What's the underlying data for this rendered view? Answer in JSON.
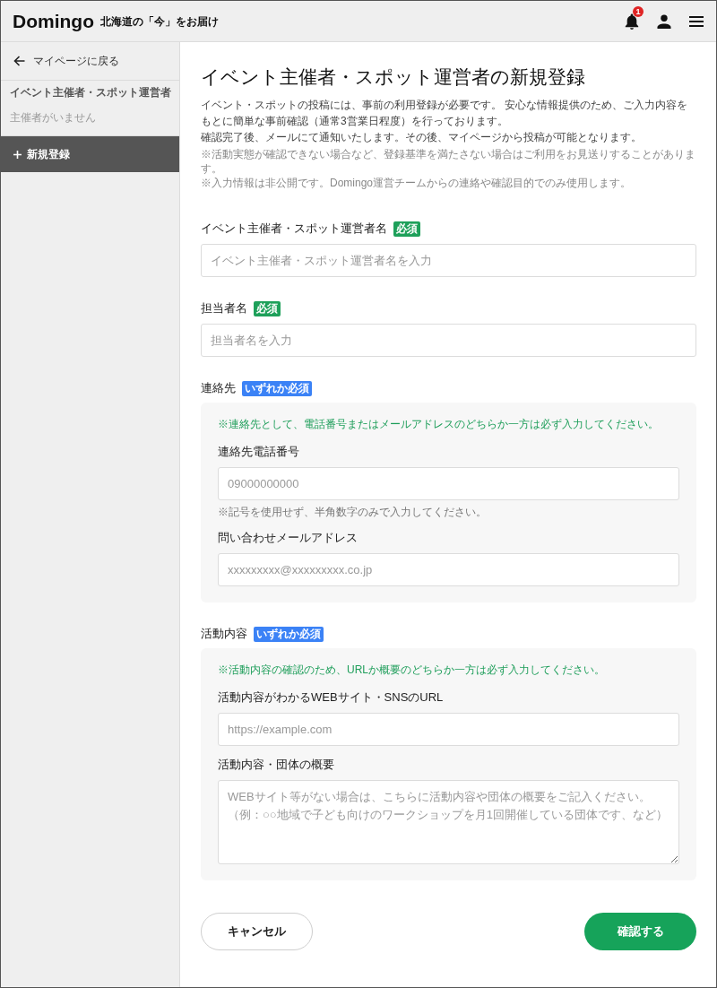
{
  "header": {
    "logo": "Domingo",
    "tagline": "北海道の「今」をお届け",
    "notification_badge": "1"
  },
  "sidebar": {
    "back_link": "マイページに戻る",
    "section_label": "イベント主催者・スポット運営者",
    "empty_message": "主催者がいません",
    "items": [
      {
        "label": "新規登録",
        "selected": true
      }
    ]
  },
  "page": {
    "title": "イベント主催者・スポット運営者の新規登録",
    "intro": [
      "イベント・スポットの投稿には、事前の利用登録が必要です。 安心な情報提供のため、ご入力内容をもとに簡単な事前確認（通常3営業日程度）を行っております。",
      "確認完了後、メールにて通知いたします。その後、マイページから投稿が可能となります。"
    ],
    "notes": [
      "※活動実態が確認できない場合など、登録基準を満たさない場合はご利用をお見送りすることがあります。",
      "※入力情報は非公開です。Domingo運営チームからの連絡や確認目的でのみ使用します。"
    ]
  },
  "form": [
    {
      "kind": "input",
      "label": "イベント主催者・スポット運営者名",
      "badge": {
        "text": "必須",
        "color": "#1ea05a"
      },
      "placeholder": "イベント主催者・スポット運営者名を入力"
    },
    {
      "kind": "input",
      "label": "担当者名",
      "badge": {
        "text": "必須",
        "color": "#1ea05a"
      },
      "placeholder": "担当者名を入力"
    },
    {
      "kind": "group",
      "label": "連絡先",
      "badge": {
        "text": "いずれか必須",
        "color": "#3b82f6"
      },
      "note": "※連絡先として、電話番号またはメールアドレスのどちらか一方は必ず入力してください。",
      "fields": [
        {
          "kind": "input",
          "label": "連絡先電話番号",
          "placeholder": "09000000000",
          "hint": "※記号を使用せず、半角数字のみで入力してください。"
        },
        {
          "kind": "input",
          "label": "問い合わせメールアドレス",
          "placeholder": "xxxxxxxxx@xxxxxxxxx.co.jp"
        }
      ]
    },
    {
      "kind": "group",
      "label": "活動内容",
      "badge": {
        "text": "いずれか必須",
        "color": "#3b82f6"
      },
      "note": "※活動内容の確認のため、URLか概要のどちらか一方は必ず入力してください。",
      "fields": [
        {
          "kind": "input",
          "label": "活動内容がわかるWEBサイト・SNSのURL",
          "placeholder": "https://example.com"
        },
        {
          "kind": "textarea",
          "label": "活動内容・団体の概要",
          "placeholder": "WEBサイト等がない場合は、こちらに活動内容や団体の概要をご記入ください。（例：○○地域で子ども向けのワークショップを月1回開催している団体です、など）"
        }
      ]
    }
  ],
  "buttons": [
    {
      "label": "キャンセル",
      "kind": "secondary"
    },
    {
      "label": "確認する",
      "kind": "primary"
    }
  ]
}
